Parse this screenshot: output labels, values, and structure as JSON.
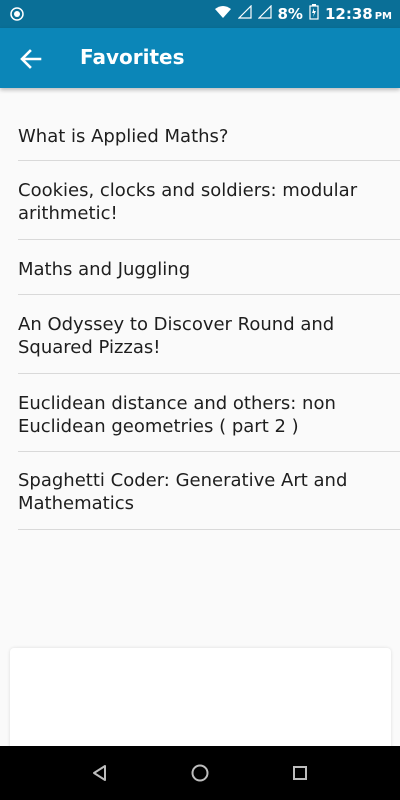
{
  "status_bar": {
    "battery": "8%",
    "time": "12:38",
    "ampm": "PM"
  },
  "app_bar": {
    "title": "Favorites"
  },
  "favorites": [
    "What is Applied Maths?",
    "Cookies, clocks and soldiers: modular arithmetic!",
    "Maths and Juggling",
    "An Odyssey to Discover Round and Squared Pizzas!",
    "Euclidean distance and others: non Euclidean geometries ( part 2 )",
    "Spaghetti Coder: Generative Art and Mathematics"
  ],
  "icons": {
    "back": "arrow-left-icon",
    "nav_back": "triangle-back-icon",
    "nav_home": "circle-home-icon",
    "nav_recents": "square-recents-icon"
  },
  "colors": {
    "status_bar": "#0a6f97",
    "app_bar": "#0b86b8",
    "background": "#fafafa",
    "nav_bar": "#000000"
  }
}
